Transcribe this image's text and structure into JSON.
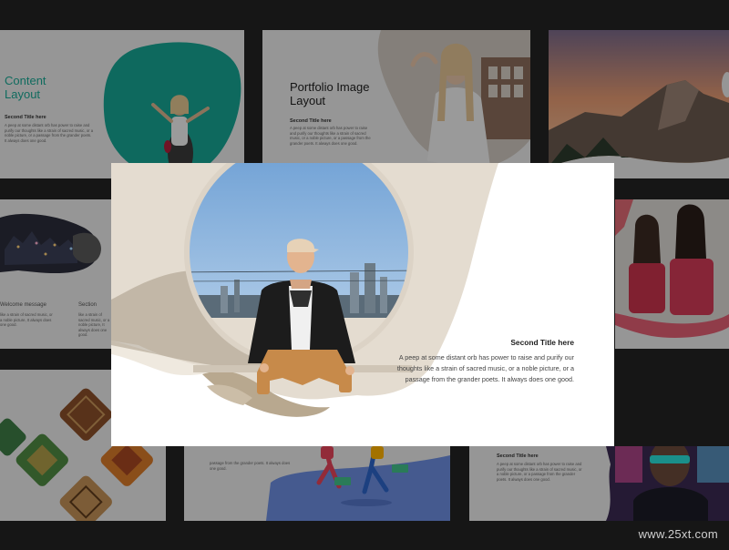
{
  "slides": {
    "content_layout": {
      "title": "Content Layout",
      "subtitle": "Second Title here",
      "body": "A peep at some distant orb has power to raise and purify our thoughts like a strain of sacred music, or a noble picture, or a passage from the grander poets. It always does one good."
    },
    "portfolio": {
      "title": "Portfolio Image Layout",
      "subtitle": "Second Title here",
      "body": "A peep at some distant orb has power to raise and purify our thoughts like a strain of sacred music, or a noble picture, or a passage from the grander poets. It always does one good."
    },
    "city": {
      "col1_title": "Welcome message",
      "col1_body": "like a strain of sacred music, or a noble picture, It always does one good.",
      "col2_title": "Section",
      "col2_body": "like a strain of sacred music, or a noble picture, It always does one good."
    },
    "dancers": {
      "body": "passage from the grander poets. It always does one good."
    },
    "glasses": {
      "subtitle": "Second Title here",
      "body": "A peep at some distant orb has power to raise and purify our thoughts like a strain of sacred music, or a noble picture, or a passage from the grander poets. It always does one good."
    }
  },
  "featured": {
    "title": "Second Title here",
    "body": "A peep at some distant orb has power to raise and purify our thoughts like a strain of sacred music, or a noble picture, or a passage from the grander poets. It always does one good."
  },
  "watermark": "www.25xt.com",
  "colors": {
    "accent": "#1aa894",
    "background": "#161616"
  }
}
